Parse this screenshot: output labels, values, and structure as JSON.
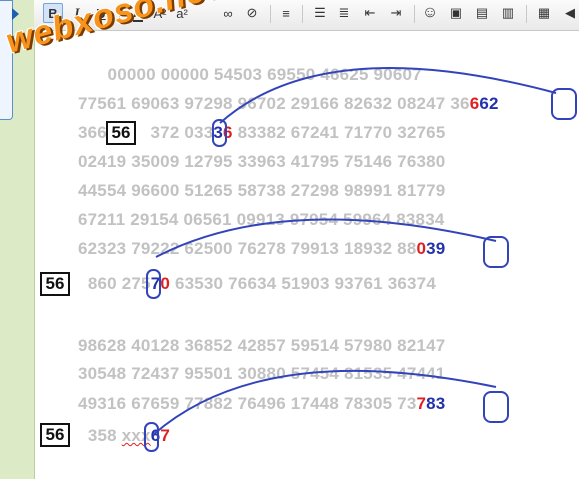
{
  "toolbar": {
    "buttons": [
      {
        "name": "bold-button",
        "glyph": "B"
      },
      {
        "name": "italic-button",
        "glyph": "I"
      },
      {
        "name": "underline-button",
        "glyph": "U"
      },
      {
        "name": "text-color-button",
        "glyph": "A"
      },
      {
        "name": "font-size-button",
        "glyph": "A²"
      },
      {
        "name": "superscript-button",
        "glyph": "a²"
      },
      {
        "name": "link-button",
        "glyph": "∞"
      },
      {
        "name": "unlink-button",
        "glyph": "⊘"
      },
      {
        "name": "align-left-button",
        "glyph": "≡"
      },
      {
        "name": "bullet-list-button",
        "glyph": "☰"
      },
      {
        "name": "numbered-list-button",
        "glyph": "≣"
      },
      {
        "name": "outdent-button",
        "glyph": "⇤"
      },
      {
        "name": "indent-button",
        "glyph": "⇥"
      },
      {
        "name": "emoji-button",
        "glyph": "☺"
      },
      {
        "name": "image-button",
        "glyph": "▣"
      },
      {
        "name": "media-button",
        "glyph": "▤"
      },
      {
        "name": "quote-button",
        "glyph": "▥"
      },
      {
        "name": "save-button",
        "glyph": "▦"
      },
      {
        "name": "undo-button",
        "glyph": "◀"
      }
    ]
  },
  "watermark": "webxoso.net",
  "result_box": "56",
  "block1": [
    {
      "pre": "      00000 00000 54503 69550 46625 90607",
      "red": "",
      "post": ""
    },
    {
      "pre": "77561 69063 97298 96702 29166 82632 08247 36",
      "red": "6",
      "blue": "62"
    },
    {
      "pre": "36662 ",
      "hide": "56",
      "pre2": "372 033",
      "blue": "3",
      "red": "6",
      "post": " 83382 67241 71770 32765"
    },
    {
      "pre": "02419 35009 12795 33963 41795 75146 76380"
    },
    {
      "pre": "44554 96600 51265 58738 27298 98991 81779"
    },
    {
      "pre": "67211 29154 06561 09913 97954 59964 83834"
    },
    {
      "pre": "62323 79222 62500 76278 79913 18932 88",
      "red": "0",
      "blue": "39"
    },
    {
      "pre": "  860 275",
      "blue": "7",
      "red": "0",
      "post": " 63530 76634 51903 93761 36374"
    }
  ],
  "block2": [
    {
      "pre": "98628 40128 36852 42857 59514 57980 82147"
    },
    {
      "pre": "30548 72437 95501 30880 57454 81535 47441"
    },
    {
      "pre": "49316 67659 77882 76496 17448 78305 73",
      "red": "7",
      "blue": "83"
    },
    {
      "pre": "  358 ",
      "wavy": "xxx",
      "blue": "6",
      "red": "7"
    }
  ]
}
